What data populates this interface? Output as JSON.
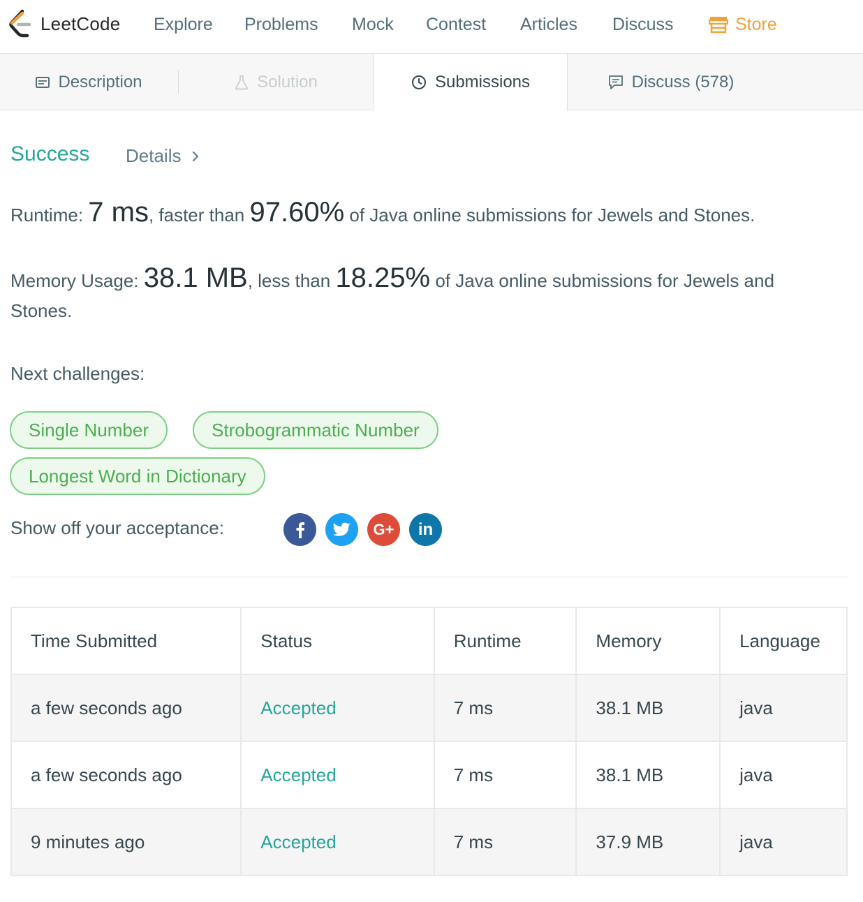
{
  "nav": {
    "logo_text": "LeetCode",
    "items": [
      "Explore",
      "Problems",
      "Mock",
      "Contest",
      "Articles",
      "Discuss"
    ],
    "store": "Store"
  },
  "tabs": {
    "description": "Description",
    "solution": "Solution",
    "submissions": "Submissions",
    "discuss": "Discuss (578)"
  },
  "result": {
    "status": "Success",
    "details": "Details",
    "runtime_label": "Runtime: ",
    "runtime_value": "7 ms",
    "runtime_mid": ", faster than ",
    "runtime_pct": "97.60%",
    "runtime_tail": " of Java online submissions for Jewels and Stones.",
    "memory_label": "Memory Usage: ",
    "memory_value": "38.1 MB",
    "memory_mid": ", less than ",
    "memory_pct": "18.25%",
    "memory_tail": " of Java online submissions for Jewels and",
    "memory_tail2": "Stones."
  },
  "next": {
    "label": "Next challenges:",
    "challenges": [
      "Single Number",
      "Strobogrammatic Number",
      "Longest Word in Dictionary"
    ]
  },
  "share": {
    "label": "Show off your acceptance:",
    "networks": [
      "facebook-icon",
      "twitter-icon",
      "google-plus-icon",
      "linkedin-icon"
    ]
  },
  "table": {
    "headers": [
      "Time Submitted",
      "Status",
      "Runtime",
      "Memory",
      "Language"
    ],
    "rows": [
      [
        "a few seconds ago",
        "Accepted",
        "7 ms",
        "38.1 MB",
        "java"
      ],
      [
        "a few seconds ago",
        "Accepted",
        "7 ms",
        "38.1 MB",
        "java"
      ],
      [
        "9 minutes ago",
        "Accepted",
        "7 ms",
        "37.9 MB",
        "java"
      ]
    ]
  },
  "colors": {
    "accent_green": "#26a69a",
    "pill_green": "#4caf50",
    "store_orange": "#f0a23b"
  }
}
